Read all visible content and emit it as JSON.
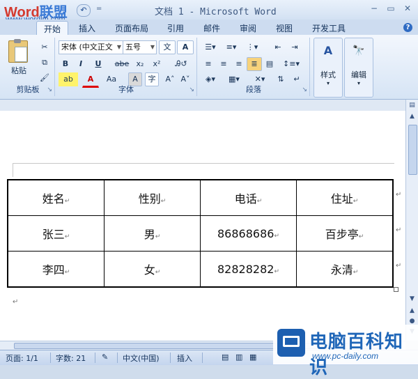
{
  "window": {
    "title": "文档 1 - Microsoft Word",
    "logo_text": "Word联盟",
    "logo_url": "www.wordlm.com",
    "undo_symbol": "↶",
    "qat_more": "=",
    "minimize": "−",
    "restore": "▭",
    "close": "✕"
  },
  "tabs": [
    "开始",
    "插入",
    "页面布局",
    "引用",
    "邮件",
    "审阅",
    "视图",
    "开发工具"
  ],
  "help": "?",
  "ribbon": {
    "clipboard": {
      "paste": "粘贴",
      "label": "剪贴板"
    },
    "font": {
      "name_value": "宋体 (中文正文",
      "size_value": "五号",
      "bold": "B",
      "italic": "I",
      "underline": "U",
      "strike": "abe",
      "subscript": "x₂",
      "superscript": "x²",
      "case": "Aa",
      "grow": "A˄",
      "shrink": "A˅",
      "clear": "A",
      "label": "字体"
    },
    "paragraph": {
      "label": "段落"
    },
    "styles": {
      "label": "样式"
    },
    "editing": {
      "label": "编辑"
    }
  },
  "table": {
    "rows": [
      [
        "姓名",
        "性别",
        "电话",
        "住址"
      ],
      [
        "张三",
        "男",
        "86868686",
        "百步亭"
      ],
      [
        "李四",
        "女",
        "82828282",
        "永清"
      ]
    ]
  },
  "status": {
    "page": "页面: 1/1",
    "words": "字数: 21",
    "language": "中文(中国)",
    "mode": "插入"
  },
  "watermark": {
    "text": "电脑百科知识",
    "url": "www.pc-daily.com"
  }
}
